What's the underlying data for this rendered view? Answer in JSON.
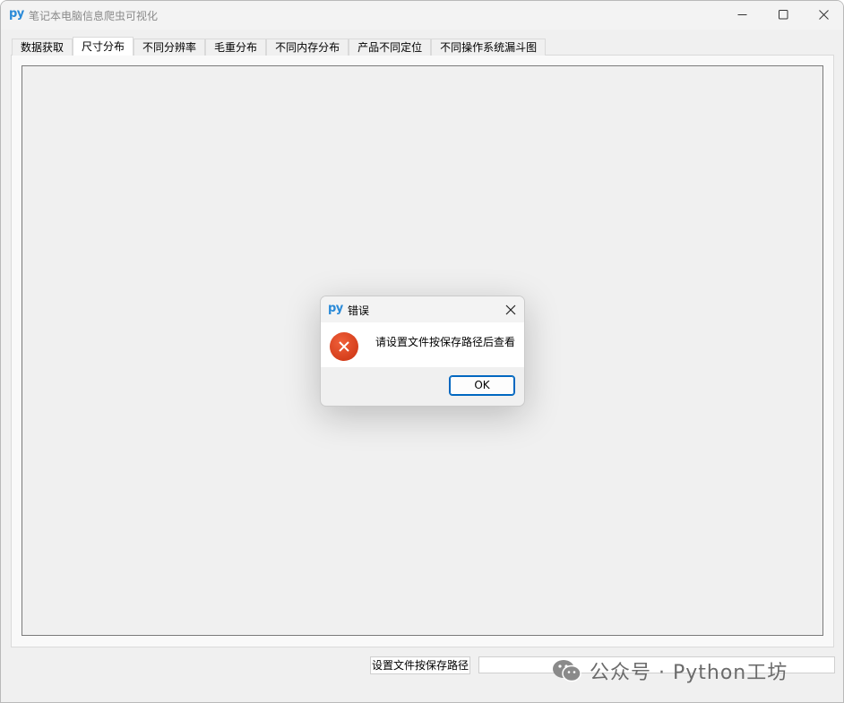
{
  "window": {
    "app_icon": "py",
    "title": "笔记本电脑信息爬虫可视化",
    "controls": [
      "minimize",
      "maximize",
      "close"
    ]
  },
  "tabs": [
    {
      "label": "数据获取",
      "active": false
    },
    {
      "label": "尺寸分布",
      "active": true
    },
    {
      "label": "不同分辨率",
      "active": false
    },
    {
      "label": "毛重分布",
      "active": false
    },
    {
      "label": "不同内存分布",
      "active": false
    },
    {
      "label": "产品不同定位",
      "active": false
    },
    {
      "label": "不同操作系统漏斗图",
      "active": false
    }
  ],
  "footer": {
    "path_button_label": "设置文件按保存路径",
    "path_input_value": ""
  },
  "dialog": {
    "app_icon": "py",
    "title": "错误",
    "icon": "error-icon",
    "message": "请设置文件按保存路径后查看",
    "ok_label": "OK"
  },
  "watermark": {
    "icon": "wechat-icon",
    "text": "公众号 · Python工坊"
  },
  "colors": {
    "accent": "#0067c0",
    "app_icon": "#2a8ad8",
    "error": "#d7411c"
  }
}
